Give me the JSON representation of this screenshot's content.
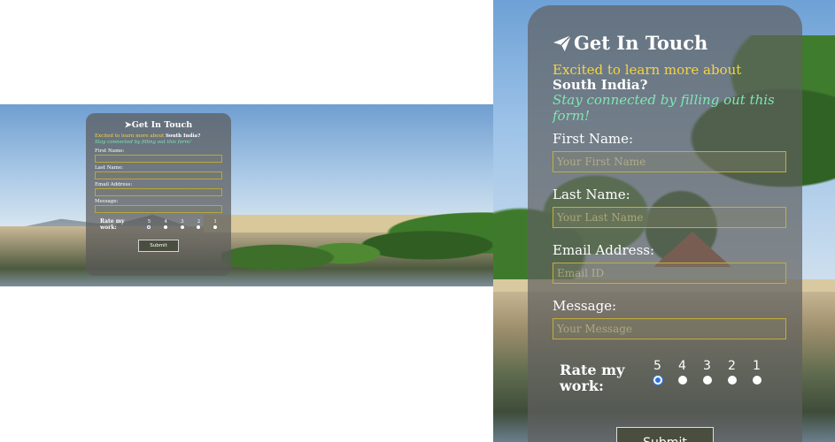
{
  "form": {
    "title": "Get In Touch",
    "intro": "Excited to learn more about ",
    "intro_strong": "South India?",
    "subtitle": "Stay connected by filling out this form!",
    "fields": [
      {
        "label": "First Name:",
        "placeholder": "Your First Name"
      },
      {
        "label": "Last Name:",
        "placeholder": "Your Last Name"
      },
      {
        "label": "Email Address:",
        "placeholder": "Email ID"
      },
      {
        "label": "Message:",
        "placeholder": "Your Message"
      }
    ],
    "rating": {
      "label": "Rate my work:",
      "options": [
        "5",
        "4",
        "3",
        "2",
        "1"
      ],
      "selected": "5"
    },
    "submit_label": "Submit"
  },
  "colors": {
    "accent_yellow": "#f5d443",
    "accent_green": "#7fe7b4",
    "button_bg": "#4a4e3f",
    "radio_selected": "#2f73d8"
  }
}
